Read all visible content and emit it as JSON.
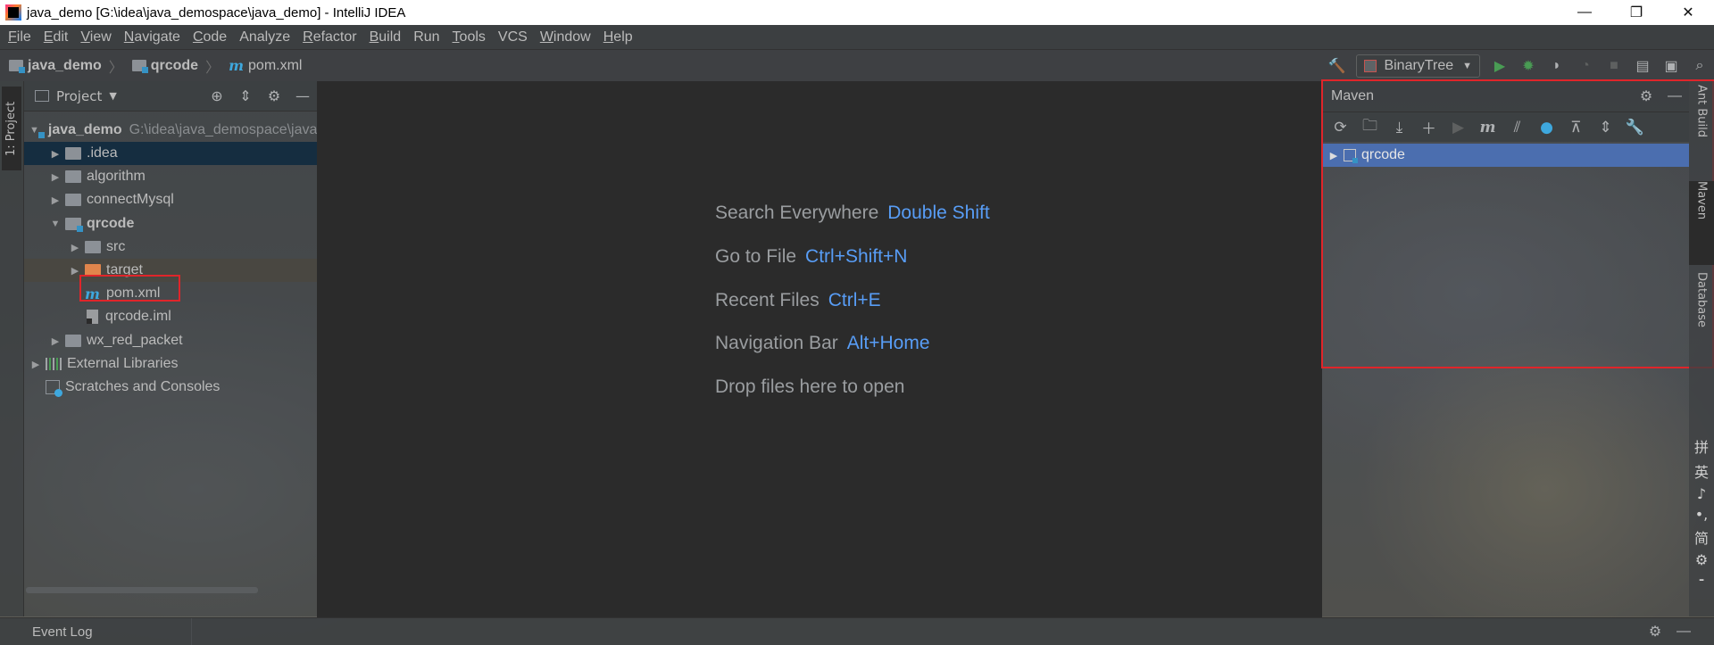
{
  "window": {
    "title": "java_demo [G:\\idea\\java_demospace\\java_demo] - IntelliJ IDEA",
    "minimize": "—",
    "restore": "❐",
    "close": "✕"
  },
  "menu": [
    {
      "first": "F",
      "rest": "ile"
    },
    {
      "first": "E",
      "rest": "dit"
    },
    {
      "first": "V",
      "rest": "iew"
    },
    {
      "first": "N",
      "rest": "avigate"
    },
    {
      "first": "C",
      "rest": "ode"
    },
    {
      "first": "",
      "rest": "Analyze"
    },
    {
      "first": "R",
      "rest": "efactor"
    },
    {
      "first": "B",
      "rest": "uild"
    },
    {
      "first": "",
      "rest": "Run"
    },
    {
      "first": "T",
      "rest": "ools"
    },
    {
      "first": "",
      "rest": "VCS"
    },
    {
      "first": "W",
      "rest": "indow"
    },
    {
      "first": "H",
      "rest": "elp"
    }
  ],
  "breadcrumb": {
    "project": "java_demo",
    "module": "qrcode",
    "file_icon": "m",
    "file": "pom.xml"
  },
  "run_config": {
    "label": "BinaryTree"
  },
  "left_stripe": {
    "project_tab": "1: Project"
  },
  "project_panel": {
    "title": "Project",
    "tree": [
      {
        "label": "java_demo",
        "path": "G:\\idea\\java_demospace\\java_demo",
        "arrow": "▼",
        "indent": 0,
        "icon": "module-folder",
        "bold": true
      },
      {
        "label": ".idea",
        "arrow": "▶",
        "indent": 1,
        "icon": "folder"
      },
      {
        "label": "algorithm",
        "arrow": "▶",
        "indent": 1,
        "icon": "folder"
      },
      {
        "label": "connectMysql",
        "arrow": "▶",
        "indent": 1,
        "icon": "folder"
      },
      {
        "label": "qrcode",
        "arrow": "▼",
        "indent": 1,
        "icon": "module-folder",
        "bold": true
      },
      {
        "label": "src",
        "arrow": "▶",
        "indent": 2,
        "icon": "folder"
      },
      {
        "label": "target",
        "arrow": "▶",
        "indent": 2,
        "icon": "orange-folder"
      },
      {
        "label": "pom.xml",
        "arrow": "",
        "indent": 2,
        "icon": "maven-file"
      },
      {
        "label": "qrcode.iml",
        "arrow": "",
        "indent": 2,
        "icon": "iml-file"
      },
      {
        "label": "wx_red_packet",
        "arrow": "▶",
        "indent": 1,
        "icon": "folder"
      },
      {
        "label": "External Libraries",
        "arrow": "▶",
        "indent": 0,
        "icon": "libraries"
      },
      {
        "label": "Scratches and Consoles",
        "arrow": "",
        "indent": 0,
        "icon": "scratches"
      }
    ]
  },
  "editor_hints": [
    {
      "text": "Search Everywhere",
      "key": "Double Shift"
    },
    {
      "text": "Go to File",
      "key": "Ctrl+Shift+N"
    },
    {
      "text": "Recent Files",
      "key": "Ctrl+E"
    },
    {
      "text": "Navigation Bar",
      "key": "Alt+Home"
    },
    {
      "text": "Drop files here to open",
      "key": ""
    }
  ],
  "maven_panel": {
    "title": "Maven",
    "tree": [
      {
        "label": "qrcode",
        "arrow": "▶"
      }
    ]
  },
  "right_stripe": {
    "ant_build": "Ant Build",
    "maven": "Maven",
    "database": "Database"
  },
  "ime": [
    "拼",
    "英",
    "♪",
    "•,",
    "简",
    "⚙",
    "⁃"
  ],
  "statusbar": {
    "event_log": "Event Log"
  },
  "colors": {
    "highlight": "#e0252a",
    "selection": "#4b6eaf",
    "accent_blue": "#589df6"
  }
}
